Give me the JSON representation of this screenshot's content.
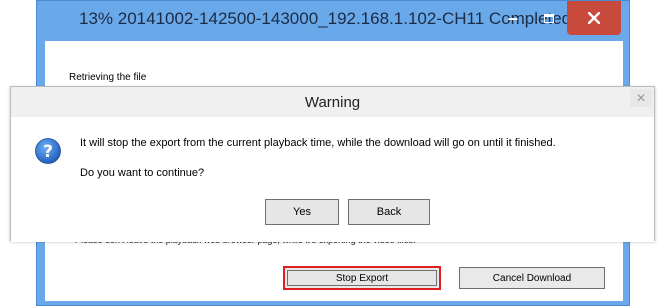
{
  "progress_window": {
    "title": "13% 20141002-142500-143000_192.168.1.102-CH11 Completed",
    "progress_percent": 13,
    "status_text": "Retrieving the file",
    "hint_text": "Please don't leave the playback web browser page, while it's exporting the video files.",
    "stop_export_label": "Stop Export",
    "cancel_download_label": "Cancel Download",
    "controls": {
      "minimize": "–",
      "close": "✕"
    }
  },
  "warning_dialog": {
    "title": "Warning",
    "icon": "question-icon",
    "message_line1": "It will stop the export from the current playback time, while the download will go on until it finished.",
    "message_line2": "Do you want to continue?",
    "yes_label": "Yes",
    "back_label": "Back",
    "close_glyph": "✕"
  },
  "colors": {
    "titlebar": "#6aa9e9",
    "close_button": "#c84a3c",
    "highlight": "#e02020",
    "question_icon": "#2a6fcb"
  }
}
